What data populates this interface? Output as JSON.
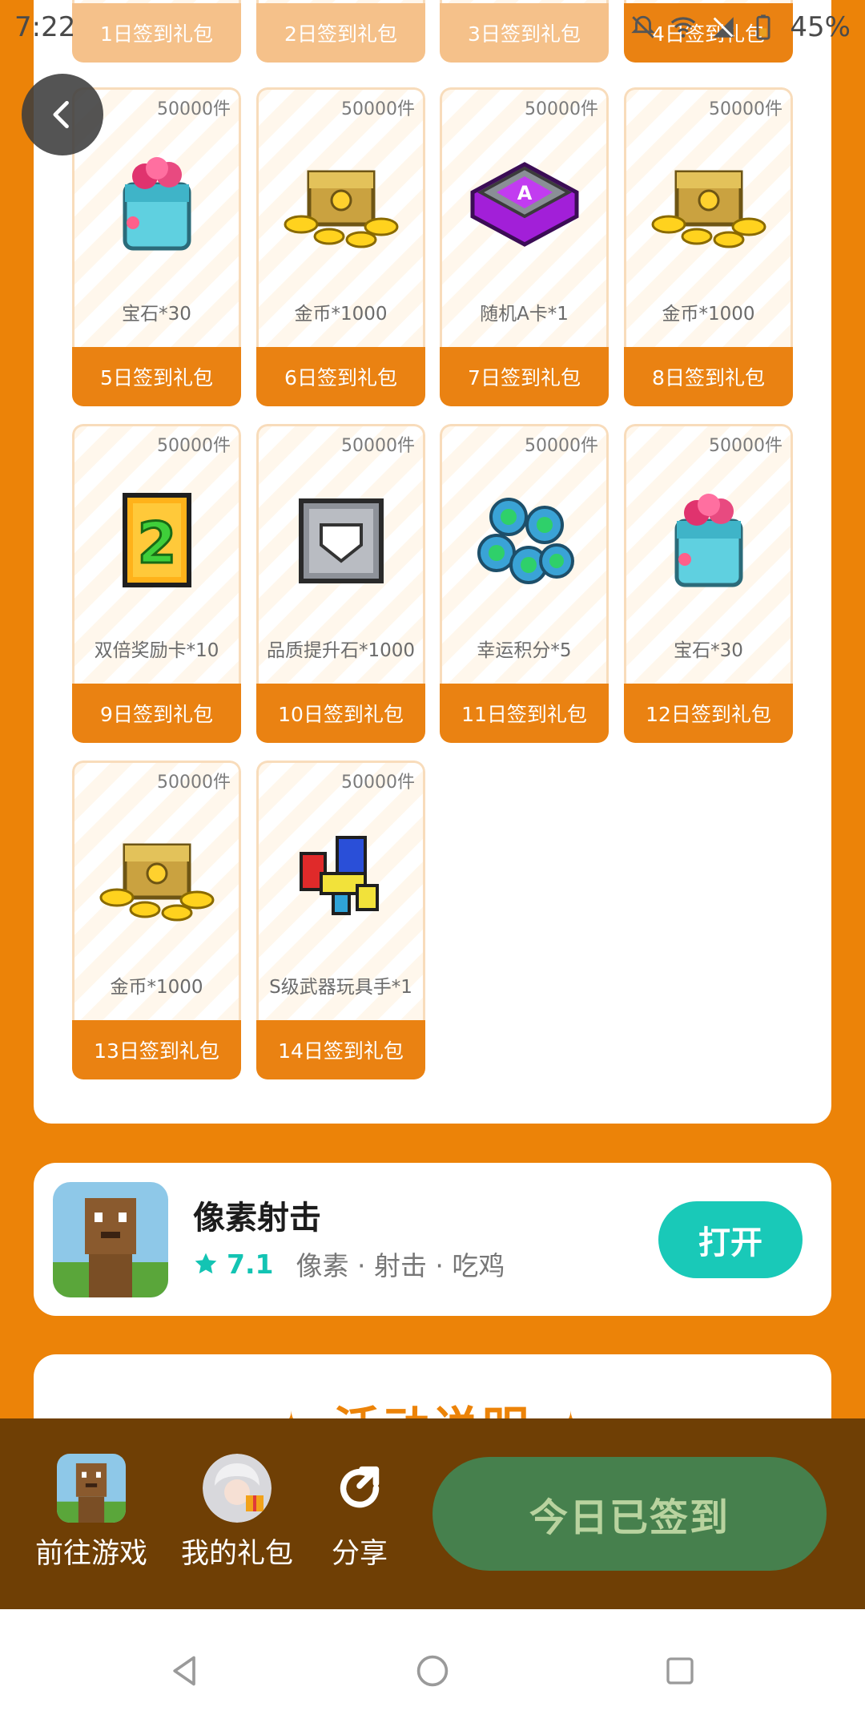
{
  "status_bar": {
    "time": "7:22",
    "battery": "45%"
  },
  "top_row": [
    {
      "label": "1日签到礼包",
      "claimed": false
    },
    {
      "label": "2日签到礼包",
      "claimed": false
    },
    {
      "label": "3日签到礼包",
      "claimed": false
    },
    {
      "label": "4日签到礼包",
      "claimed": true
    }
  ],
  "gifts": [
    {
      "stock": "50000件",
      "name": "宝石*30",
      "label": "5日签到礼包",
      "icon": "gem-box-icon"
    },
    {
      "stock": "50000件",
      "name": "金币*1000",
      "label": "6日签到礼包",
      "icon": "gold-chest-icon"
    },
    {
      "stock": "50000件",
      "name": "随机A卡*1",
      "label": "7日签到礼包",
      "icon": "a-card-icon"
    },
    {
      "stock": "50000件",
      "name": "金币*1000",
      "label": "8日签到礼包",
      "icon": "gold-chest-icon"
    },
    {
      "stock": "50000件",
      "name": "双倍奖励卡*10",
      "label": "9日签到礼包",
      "icon": "double-card-icon"
    },
    {
      "stock": "50000件",
      "name": "品质提升石*1000",
      "label": "10日签到礼包",
      "icon": "upgrade-stone-icon"
    },
    {
      "stock": "50000件",
      "name": "幸运积分*5",
      "label": "11日签到礼包",
      "icon": "clover-coin-icon"
    },
    {
      "stock": "50000件",
      "name": "宝石*30",
      "label": "12日签到礼包",
      "icon": "gem-box-icon"
    },
    {
      "stock": "50000件",
      "name": "金币*1000",
      "label": "13日签到礼包",
      "icon": "gold-chest-icon"
    },
    {
      "stock": "50000件",
      "name": "S级武器玩具手*1",
      "label": "14日签到礼包",
      "icon": "weapon-toy-icon"
    }
  ],
  "game": {
    "title": "像素射击",
    "rating": "7.1",
    "tags": "像素 · 射击 · 吃鸡",
    "open_label": "打开"
  },
  "activity": {
    "title": "✦ 活动说明 ✦"
  },
  "bottom_bar": {
    "go_game": "前往游戏",
    "my_gifts": "我的礼包",
    "share": "分享",
    "checkin": "今日已签到"
  },
  "colors": {
    "brand_orange": "#ec8308",
    "teal": "#19c9b8",
    "checked_green": "#46804d",
    "bar_brown": "#6f3f05"
  }
}
